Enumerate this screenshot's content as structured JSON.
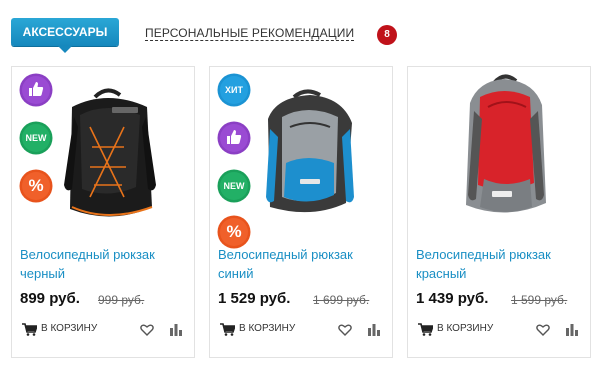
{
  "tabs": {
    "active_label": "АКСЕССУАРЫ",
    "recommend_label": "ПЕРСОНАЛЬНЫЕ РЕКОМЕНДАЦИИ",
    "recommend_count": "8"
  },
  "badge_labels": {
    "like": "like-thumb",
    "new": "NEW",
    "hit": "ХИТ",
    "sale": "%"
  },
  "colors": {
    "accent": "#1a8fc4",
    "badge_purple": "#8b3fc4",
    "badge_green": "#1aa05a",
    "badge_orange": "#e8531c",
    "badge_blue": "#1b93d3",
    "count_red": "#c0121a"
  },
  "products": [
    {
      "title": "Велосипедный рюкзак черный",
      "price": "899 руб.",
      "old_price": "999 руб.",
      "cart_label": "В КОРЗИНУ"
    },
    {
      "title": "Велосипедный рюкзак синий",
      "price": "1 529 руб.",
      "old_price": "1 699 руб.",
      "cart_label": "В КОРЗИНУ"
    },
    {
      "title": "Велосипедный рюкзак красный",
      "price": "1 439 руб.",
      "old_price": "1 599 руб.",
      "cart_label": "В КОРЗИНУ"
    }
  ]
}
